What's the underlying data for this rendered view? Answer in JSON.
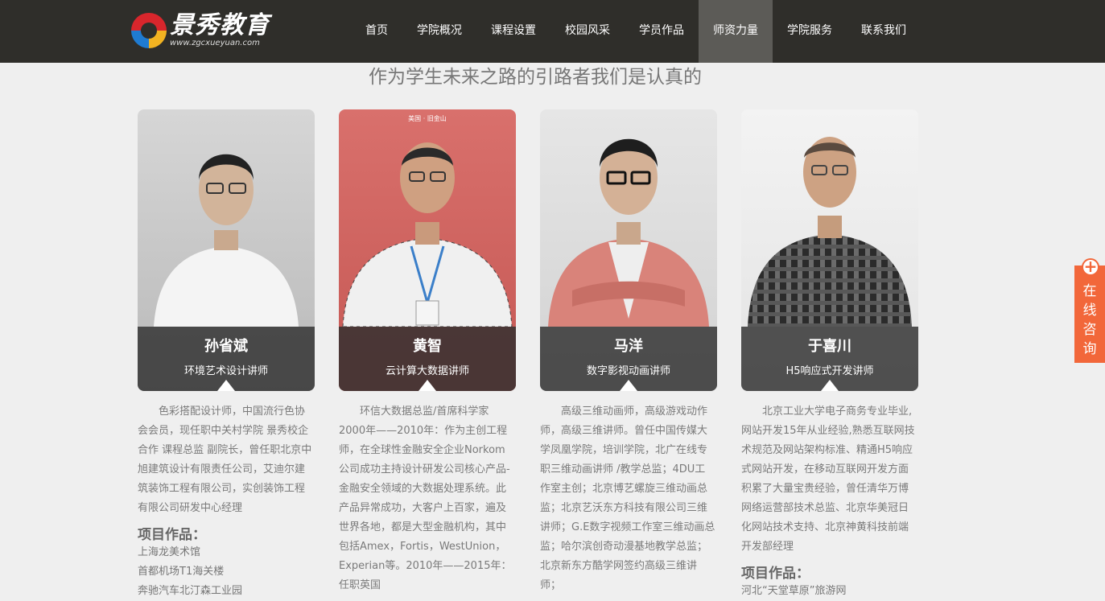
{
  "logo": {
    "brand": "景秀教育",
    "url_text": "www.zgcxueyuan.com"
  },
  "nav": [
    {
      "label": "首页"
    },
    {
      "label": "学院概况"
    },
    {
      "label": "课程设置"
    },
    {
      "label": "校园风采"
    },
    {
      "label": "学员作品"
    },
    {
      "label": "师资力量",
      "active": true
    },
    {
      "label": "学院服务"
    },
    {
      "label": "联系我们"
    }
  ],
  "section_title": "作为学生未来之路的引路者我们是认真的",
  "teachers": [
    {
      "name": "孙省斌",
      "title": "环境艺术设计讲师",
      "bio": "色彩搭配设计师，中国流行色协会会员，现任职中关村学院 景秀校企合作 课程总监 副院长，曾任职北京中旭建筑设计有限责任公司，艾迪尔建筑装饰工程有限公司，实创装饰工程有限公司研发中心经理",
      "works_heading": "项目作品：",
      "works": [
        "上海龙美术馆",
        "首都机场T1海关楼",
        "奔驰汽车北汀森工业园"
      ]
    },
    {
      "name": "黄智",
      "title": "云计算大数据讲师",
      "photo_caption": "美国 · 旧金山",
      "bio": "环信大数据总监/首席科学家2000年——2010年：作为主创工程师，在全球性金融安全企业Norkom公司成功主持设计研发公司核心产品-金融安全领域的大数据处理系统。此产品异常成功，大客户上百家，遍及世界各地，都是大型金融机构，其中包括Amex，Fortis，WestUnion，Experian等。2010年——2015年：任职英国"
    },
    {
      "name": "马洋",
      "title": "数字影视动画讲师",
      "bio": "高级三维动画师，高级游戏动作师，高级三维讲师。曾任中国传媒大学凤凰学院，培训学院，北广在线专职三维动画讲师 /教学总监；4DU工作室主创；北京博艺螺旋三维动画总监；北京艺沃东方科技有限公司三维讲师；G.E数字视频工作室三维动画总监；哈尔滨创奇动漫基地教学总监；北京新东方酷学网签约高级三维讲师；"
    },
    {
      "name": "于喜川",
      "title": "H5响应式开发讲师",
      "bio": "北京工业大学电子商务专业毕业, 网站开发15年从业经验,熟悉互联网技术规范及网站架构标准、精通H5响应式网站开发，在移动互联网开发方面积累了大量宝贵经验，曾任清华万博网络运营部技术总监、北京华美冠日化网站技术支持、北京神黄科技前端开发部经理",
      "works_heading": "项目作品：",
      "works": [
        "河北“天堂草原”旅游网"
      ]
    }
  ],
  "consult": {
    "label": "在线咨询",
    "icon": "plus-icon"
  },
  "colors": {
    "header": "#2f2e2a",
    "nav_active": "#5c5b57",
    "consult": "#f2673a",
    "page_bg": "#efefef"
  }
}
